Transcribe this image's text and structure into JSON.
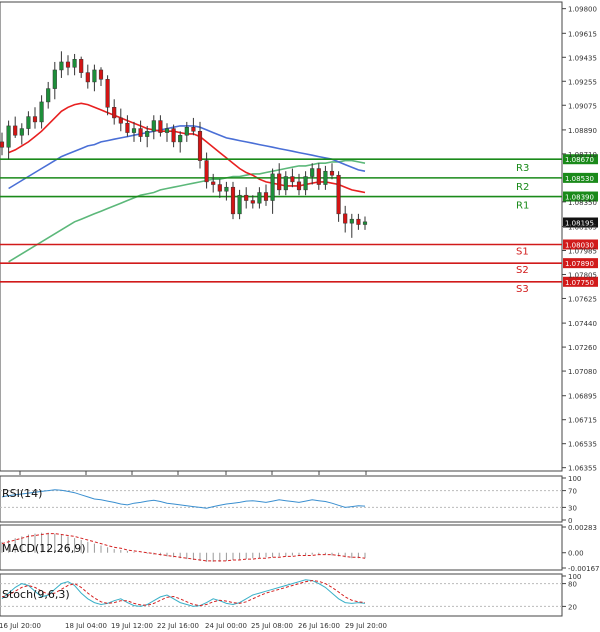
{
  "chart_data": {
    "type": "candlestick",
    "price_axis": {
      "ticks": [
        "1.09800",
        "1.09615",
        "1.09435",
        "1.09255",
        "1.09075",
        "1.08890",
        "1.08710",
        "1.08350",
        "1.08165",
        "1.07985",
        "1.07805",
        "1.07625",
        "1.07440",
        "1.07260",
        "1.07080",
        "1.06895",
        "1.06715",
        "1.06535",
        "1.06355"
      ],
      "ylim": [
        1.0633,
        1.0985
      ]
    },
    "time_axis": {
      "labels": [
        "16 Jul 20:00",
        "18 Jul 04:00",
        "19 Jul 12:00",
        "22 Jul 16:00",
        "24 Jul 00:00",
        "25 Jul 08:00",
        "26 Jul 16:00",
        "29 Jul 20:00"
      ]
    },
    "current_price": {
      "label": "1.08195",
      "value": 1.08195
    },
    "levels": [
      {
        "name": "R3",
        "label": "1.08670",
        "value": 1.0867,
        "color": "#1a8a1a"
      },
      {
        "name": "R2",
        "label": "1.08530",
        "value": 1.0853,
        "color": "#1a8a1a"
      },
      {
        "name": "R1",
        "label": "1.08390",
        "value": 1.0839,
        "color": "#1a8a1a"
      },
      {
        "name": "S1",
        "label": "1.08030",
        "value": 1.0803,
        "color": "#d11a1a"
      },
      {
        "name": "S2",
        "label": "1.07890",
        "value": 1.0789,
        "color": "#d11a1a"
      },
      {
        "name": "S3",
        "label": "1.07750",
        "value": 1.0775,
        "color": "#d11a1a"
      }
    ],
    "candles": [
      {
        "o": 1.088,
        "h": 1.0887,
        "l": 1.087,
        "c": 1.0876
      },
      {
        "o": 1.0876,
        "h": 1.0896,
        "l": 1.0867,
        "c": 1.0892
      },
      {
        "o": 1.0892,
        "h": 1.0899,
        "l": 1.0883,
        "c": 1.0885
      },
      {
        "o": 1.0885,
        "h": 1.0894,
        "l": 1.0878,
        "c": 1.089
      },
      {
        "o": 1.089,
        "h": 1.0903,
        "l": 1.0885,
        "c": 1.0899
      },
      {
        "o": 1.0899,
        "h": 1.0906,
        "l": 1.089,
        "c": 1.0895
      },
      {
        "o": 1.0895,
        "h": 1.0915,
        "l": 1.089,
        "c": 1.091
      },
      {
        "o": 1.091,
        "h": 1.0925,
        "l": 1.0905,
        "c": 1.092
      },
      {
        "o": 1.092,
        "h": 1.094,
        "l": 1.0912,
        "c": 1.0934
      },
      {
        "o": 1.0934,
        "h": 1.0948,
        "l": 1.0928,
        "c": 1.094
      },
      {
        "o": 1.094,
        "h": 1.0945,
        "l": 1.093,
        "c": 1.0936
      },
      {
        "o": 1.0936,
        "h": 1.0946,
        "l": 1.093,
        "c": 1.0942
      },
      {
        "o": 1.0942,
        "h": 1.0944,
        "l": 1.0928,
        "c": 1.0932
      },
      {
        "o": 1.0932,
        "h": 1.0938,
        "l": 1.092,
        "c": 1.0925
      },
      {
        "o": 1.0925,
        "h": 1.0938,
        "l": 1.0918,
        "c": 1.0934
      },
      {
        "o": 1.0934,
        "h": 1.0936,
        "l": 1.0922,
        "c": 1.0927
      },
      {
        "o": 1.0927,
        "h": 1.093,
        "l": 1.09,
        "c": 1.0906
      },
      {
        "o": 1.0906,
        "h": 1.0912,
        "l": 1.0893,
        "c": 1.0898
      },
      {
        "o": 1.0898,
        "h": 1.0905,
        "l": 1.0888,
        "c": 1.0894
      },
      {
        "o": 1.0894,
        "h": 1.09,
        "l": 1.0884,
        "c": 1.0887
      },
      {
        "o": 1.0887,
        "h": 1.0895,
        "l": 1.088,
        "c": 1.089
      },
      {
        "o": 1.089,
        "h": 1.0896,
        "l": 1.088,
        "c": 1.0884
      },
      {
        "o": 1.0884,
        "h": 1.0892,
        "l": 1.0876,
        "c": 1.0888
      },
      {
        "o": 1.0888,
        "h": 1.09,
        "l": 1.0882,
        "c": 1.0896
      },
      {
        "o": 1.0896,
        "h": 1.09,
        "l": 1.0884,
        "c": 1.0887
      },
      {
        "o": 1.0887,
        "h": 1.0894,
        "l": 1.088,
        "c": 1.089
      },
      {
        "o": 1.089,
        "h": 1.0893,
        "l": 1.0876,
        "c": 1.088
      },
      {
        "o": 1.088,
        "h": 1.0888,
        "l": 1.0872,
        "c": 1.0885
      },
      {
        "o": 1.0885,
        "h": 1.0895,
        "l": 1.088,
        "c": 1.0891
      },
      {
        "o": 1.0891,
        "h": 1.0898,
        "l": 1.0885,
        "c": 1.0888
      },
      {
        "o": 1.0888,
        "h": 1.0895,
        "l": 1.086,
        "c": 1.0866
      },
      {
        "o": 1.0866,
        "h": 1.0872,
        "l": 1.0845,
        "c": 1.085
      },
      {
        "o": 1.085,
        "h": 1.0856,
        "l": 1.0842,
        "c": 1.0848
      },
      {
        "o": 1.0848,
        "h": 1.0852,
        "l": 1.0838,
        "c": 1.0843
      },
      {
        "o": 1.0843,
        "h": 1.085,
        "l": 1.0836,
        "c": 1.0846
      },
      {
        "o": 1.0846,
        "h": 1.085,
        "l": 1.0822,
        "c": 1.0826
      },
      {
        "o": 1.0826,
        "h": 1.0844,
        "l": 1.0822,
        "c": 1.084
      },
      {
        "o": 1.084,
        "h": 1.0846,
        "l": 1.083,
        "c": 1.0836
      },
      {
        "o": 1.0836,
        "h": 1.084,
        "l": 1.083,
        "c": 1.0834
      },
      {
        "o": 1.0834,
        "h": 1.0846,
        "l": 1.083,
        "c": 1.0842
      },
      {
        "o": 1.0842,
        "h": 1.0848,
        "l": 1.0832,
        "c": 1.0836
      },
      {
        "o": 1.0836,
        "h": 1.086,
        "l": 1.0826,
        "c": 1.0856
      },
      {
        "o": 1.0856,
        "h": 1.0864,
        "l": 1.084,
        "c": 1.0844
      },
      {
        "o": 1.0844,
        "h": 1.0858,
        "l": 1.084,
        "c": 1.0854
      },
      {
        "o": 1.0854,
        "h": 1.086,
        "l": 1.0846,
        "c": 1.085
      },
      {
        "o": 1.085,
        "h": 1.0856,
        "l": 1.084,
        "c": 1.0844
      },
      {
        "o": 1.0844,
        "h": 1.0858,
        "l": 1.084,
        "c": 1.0854
      },
      {
        "o": 1.0854,
        "h": 1.0864,
        "l": 1.0848,
        "c": 1.086
      },
      {
        "o": 1.086,
        "h": 1.0864,
        "l": 1.0844,
        "c": 1.0848
      },
      {
        "o": 1.0848,
        "h": 1.0862,
        "l": 1.0844,
        "c": 1.0858
      },
      {
        "o": 1.0858,
        "h": 1.0864,
        "l": 1.0852,
        "c": 1.0855
      },
      {
        "o": 1.0855,
        "h": 1.0858,
        "l": 1.082,
        "c": 1.0826
      },
      {
        "o": 1.0826,
        "h": 1.0832,
        "l": 1.0812,
        "c": 1.0819
      },
      {
        "o": 1.0819,
        "h": 1.0826,
        "l": 1.0808,
        "c": 1.0822
      },
      {
        "o": 1.0822,
        "h": 1.0826,
        "l": 1.0814,
        "c": 1.0818
      },
      {
        "o": 1.0818,
        "h": 1.0824,
        "l": 1.0814,
        "c": 1.082
      }
    ],
    "ma_red": [
      1.0872,
      1.0874,
      1.0877,
      1.088,
      1.0884,
      1.0888,
      1.0893,
      1.0898,
      1.0903,
      1.0906,
      1.0908,
      1.0909,
      1.0908,
      1.0906,
      1.0904,
      1.0902,
      1.09,
      1.0898,
      1.0896,
      1.0894,
      1.0892,
      1.089,
      1.0889,
      1.0888,
      1.0888,
      1.0888,
      1.0887,
      1.0886,
      1.0886,
      1.0884,
      1.088,
      1.0876,
      1.0872,
      1.0868,
      1.0864,
      1.086,
      1.0857,
      1.0855,
      1.0852,
      1.085,
      1.0849,
      1.0848,
      1.0847,
      1.0847,
      1.0847,
      1.0848,
      1.0849,
      1.085,
      1.085,
      1.0849,
      1.0848,
      1.0846,
      1.0844,
      1.0843,
      1.0842
    ],
    "ma_blue": [
      1.0845,
      1.0848,
      1.0851,
      1.0854,
      1.0857,
      1.086,
      1.0863,
      1.0866,
      1.0869,
      1.0871,
      1.0873,
      1.0875,
      1.0877,
      1.0878,
      1.088,
      1.0881,
      1.0882,
      1.0883,
      1.0884,
      1.0885,
      1.0886,
      1.0887,
      1.0888,
      1.0889,
      1.089,
      1.0891,
      1.0892,
      1.0892,
      1.0892,
      1.0891,
      1.0889,
      1.0887,
      1.0885,
      1.0883,
      1.0882,
      1.0881,
      1.088,
      1.0879,
      1.0878,
      1.0877,
      1.0876,
      1.0875,
      1.0874,
      1.0873,
      1.0872,
      1.0871,
      1.087,
      1.0869,
      1.0868,
      1.0867,
      1.0865,
      1.0863,
      1.0861,
      1.0859,
      1.0858
    ],
    "ma_green": [
      1.079,
      1.0793,
      1.0796,
      1.0799,
      1.0802,
      1.0805,
      1.0808,
      1.0811,
      1.0814,
      1.0817,
      1.082,
      1.0822,
      1.0824,
      1.0826,
      1.0828,
      1.083,
      1.0832,
      1.0834,
      1.0836,
      1.0838,
      1.084,
      1.0841,
      1.0842,
      1.0844,
      1.0845,
      1.0846,
      1.0847,
      1.0848,
      1.0849,
      1.085,
      1.0851,
      1.0852,
      1.0852,
      1.0853,
      1.0854,
      1.0854,
      1.0855,
      1.0856,
      1.0856,
      1.0857,
      1.0858,
      1.0859,
      1.086,
      1.0861,
      1.0862,
      1.0862,
      1.0863,
      1.0864,
      1.0864,
      1.0865,
      1.0865,
      1.0866,
      1.0866,
      1.0865,
      1.0864
    ],
    "rsi": {
      "title": "RSI(14)",
      "ticks": [
        "100",
        "70",
        "30",
        "0"
      ],
      "values": [
        55,
        58,
        60,
        62,
        64,
        66,
        68,
        70,
        72,
        71,
        68,
        65,
        60,
        55,
        50,
        48,
        45,
        42,
        38,
        36,
        40,
        42,
        45,
        47,
        44,
        40,
        38,
        36,
        34,
        32,
        30,
        28,
        32,
        35,
        38,
        40,
        42,
        45,
        46,
        44,
        42,
        45,
        48,
        46,
        44,
        42,
        45,
        48,
        46,
        44,
        40,
        35,
        30,
        32,
        34,
        33
      ]
    },
    "macd": {
      "title": "MACD(12,26,9)",
      "ticks": [
        "0.00283",
        "0.00",
        "-0.001679"
      ],
      "hist": [
        0.0012,
        0.0014,
        0.0016,
        0.0018,
        0.002,
        0.0021,
        0.0022,
        0.0022,
        0.0021,
        0.002,
        0.0018,
        0.0016,
        0.0014,
        0.0012,
        0.001,
        0.0008,
        0.0006,
        0.0004,
        0.0003,
        0.0002,
        0.0001,
        0.0,
        -0.0001,
        -0.0002,
        -0.0003,
        -0.0004,
        -0.0005,
        -0.0006,
        -0.0007,
        -0.0008,
        -0.0009,
        -0.001,
        -0.001,
        -0.001,
        -0.0009,
        -0.0008,
        -0.0008,
        -0.0007,
        -0.0006,
        -0.0006,
        -0.0005,
        -0.0005,
        -0.0004,
        -0.0004,
        -0.0003,
        -0.0003,
        -0.0003,
        -0.0002,
        -0.0002,
        -0.0002,
        -0.0003,
        -0.0004,
        -0.0005,
        -0.0006,
        -0.0006,
        -0.0006
      ],
      "signal": [
        0.001,
        0.0012,
        0.0014,
        0.0016,
        0.0018,
        0.0019,
        0.002,
        0.0021,
        0.0021,
        0.002,
        0.0019,
        0.0018,
        0.0016,
        0.0014,
        0.0012,
        0.001,
        0.0008,
        0.0006,
        0.0005,
        0.0003,
        0.0002,
        0.0001,
        0.0,
        -0.0001,
        -0.0002,
        -0.0003,
        -0.0004,
        -0.0005,
        -0.0006,
        -0.0007,
        -0.0008,
        -0.0009,
        -0.0009,
        -0.0009,
        -0.0009,
        -0.0008,
        -0.0008,
        -0.0007,
        -0.0007,
        -0.0006,
        -0.0006,
        -0.0005,
        -0.0005,
        -0.0004,
        -0.0004,
        -0.0003,
        -0.0003,
        -0.0003,
        -0.0002,
        -0.0002,
        -0.0002,
        -0.0003,
        -0.0004,
        -0.0005,
        -0.0005,
        -0.0006
      ]
    },
    "stoch": {
      "title": "Stoch(9,6,3)",
      "ticks": [
        "100",
        "80",
        "20"
      ],
      "k": [
        40,
        55,
        70,
        80,
        75,
        60,
        45,
        50,
        65,
        80,
        85,
        75,
        55,
        40,
        30,
        25,
        28,
        35,
        40,
        30,
        22,
        20,
        25,
        35,
        45,
        50,
        40,
        30,
        25,
        20,
        22,
        30,
        40,
        35,
        28,
        25,
        30,
        40,
        50,
        55,
        60,
        65,
        70,
        75,
        80,
        85,
        90,
        88,
        80,
        70,
        55,
        40,
        30,
        28,
        30,
        28
      ],
      "d": [
        45,
        50,
        60,
        70,
        75,
        70,
        60,
        52,
        55,
        65,
        75,
        80,
        70,
        55,
        42,
        32,
        28,
        30,
        35,
        35,
        28,
        24,
        23,
        28,
        36,
        44,
        46,
        40,
        32,
        25,
        22,
        25,
        32,
        36,
        34,
        30,
        28,
        32,
        40,
        48,
        55,
        60,
        65,
        70,
        75,
        80,
        85,
        88,
        86,
        80,
        70,
        58,
        45,
        36,
        32,
        30
      ]
    }
  }
}
